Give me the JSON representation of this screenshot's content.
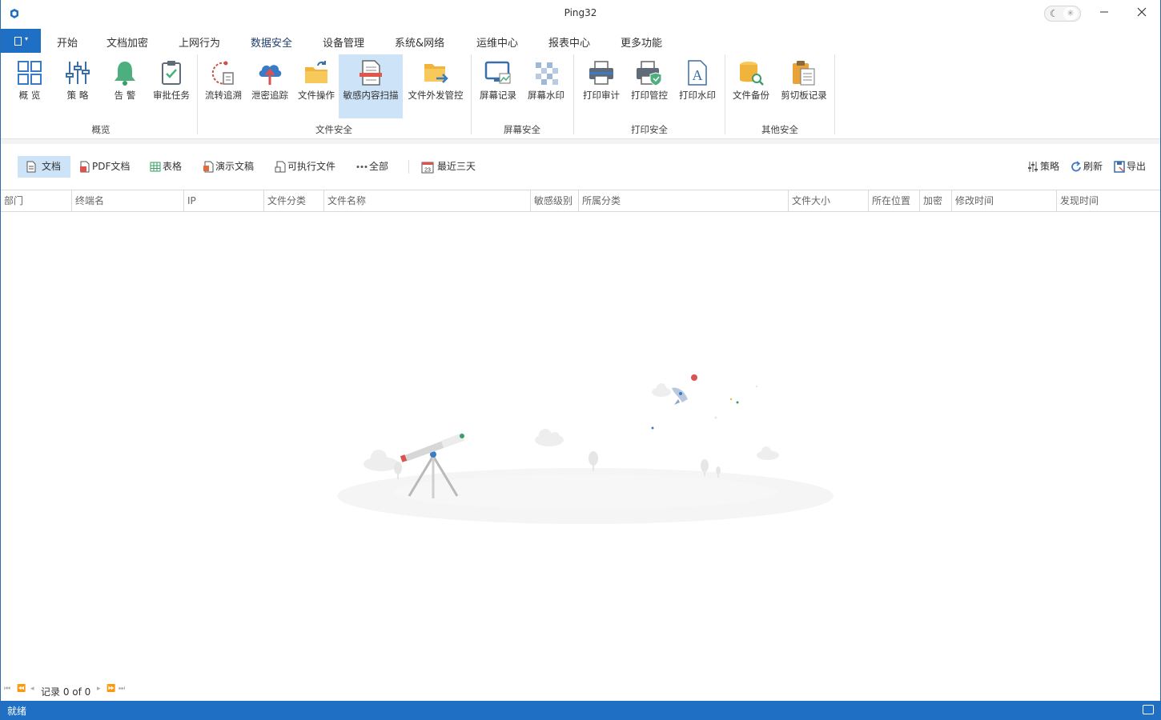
{
  "window": {
    "title": "Ping32"
  },
  "menu": {
    "tabs": [
      {
        "label": "开始"
      },
      {
        "label": "文档加密"
      },
      {
        "label": "上网行为"
      },
      {
        "label": "数据安全"
      },
      {
        "label": "设备管理"
      },
      {
        "label": "系统&网络"
      },
      {
        "label": "运维中心"
      },
      {
        "label": "报表中心"
      },
      {
        "label": "更多功能"
      }
    ],
    "active_tab": "数据安全"
  },
  "ribbon": {
    "groups": [
      {
        "label": "概览",
        "items": [
          {
            "label": "概  览",
            "icon": "overview-grid-icon"
          },
          {
            "label": "策  略",
            "icon": "policy-sliders-icon"
          },
          {
            "label": "告  警",
            "icon": "alert-bell-icon"
          },
          {
            "label": "审批任务",
            "icon": "approval-clipboard-icon"
          }
        ]
      },
      {
        "label": "文件安全",
        "items": [
          {
            "label": "流转追溯",
            "icon": "trace-flow-icon"
          },
          {
            "label": "泄密追踪",
            "icon": "leak-cloud-icon"
          },
          {
            "label": "文件操作",
            "icon": "file-operation-folder-icon"
          },
          {
            "label": "敏感内容扫描",
            "icon": "sensitive-scan-icon",
            "selected": true
          },
          {
            "label": "文件外发管控",
            "icon": "outbound-folder-icon"
          }
        ]
      },
      {
        "label": "屏幕安全",
        "items": [
          {
            "label": "屏幕记录",
            "icon": "screen-record-icon"
          },
          {
            "label": "屏幕水印",
            "icon": "screen-watermark-icon"
          }
        ]
      },
      {
        "label": "打印安全",
        "items": [
          {
            "label": "打印审计",
            "icon": "print-audit-icon"
          },
          {
            "label": "打印管控",
            "icon": "print-control-icon"
          },
          {
            "label": "打印水印",
            "icon": "print-watermark-icon"
          }
        ]
      },
      {
        "label": "其他安全",
        "items": [
          {
            "label": "文件备份",
            "icon": "file-backup-icon"
          },
          {
            "label": "剪切板记录",
            "icon": "clipboard-record-icon"
          }
        ]
      }
    ]
  },
  "filters": {
    "types": [
      {
        "label": "文档",
        "icon": "document-icon",
        "active": true
      },
      {
        "label": "PDF文档",
        "icon": "pdf-icon"
      },
      {
        "label": "表格",
        "icon": "spreadsheet-icon"
      },
      {
        "label": "演示文稿",
        "icon": "presentation-icon"
      },
      {
        "label": "可执行文件",
        "icon": "executable-icon"
      },
      {
        "label": "全部",
        "icon": "more-dots-icon"
      }
    ],
    "date_range": {
      "label": "最近三天",
      "icon": "calendar-icon",
      "icon_text": "23"
    },
    "actions": [
      {
        "label": "策略",
        "icon": "policy-icon"
      },
      {
        "label": "刷新",
        "icon": "refresh-icon"
      },
      {
        "label": "导出",
        "icon": "export-icon"
      }
    ]
  },
  "table": {
    "columns": [
      "部门",
      "终端名",
      "IP",
      "文件分类",
      "文件名称",
      "敏感级别",
      "所属分类",
      "文件大小",
      "所在位置",
      "加密",
      "修改时间",
      "发现时间"
    ],
    "rows": []
  },
  "pager": {
    "text": "记录 0 of 0"
  },
  "status": {
    "text": "就绪"
  },
  "colors": {
    "accent": "#1f6fc5",
    "selected": "#cde3f7"
  }
}
